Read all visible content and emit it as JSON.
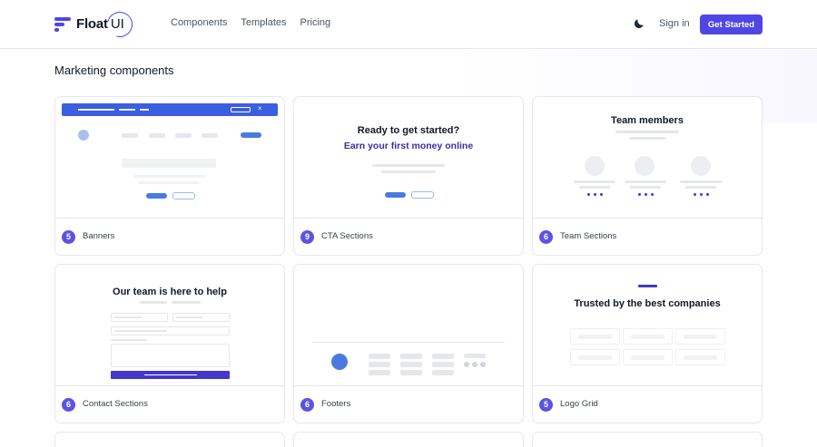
{
  "brand": {
    "name": "Float",
    "suffix": "UI"
  },
  "nav": [
    "Components",
    "Templates",
    "Pricing"
  ],
  "header": {
    "signin": "Sign in",
    "cta": "Get Started"
  },
  "section_title": "Marketing components",
  "cards": [
    {
      "count": "5",
      "label": "Banners"
    },
    {
      "count": "9",
      "label": "CTA Sections",
      "heading": "Ready to get started?",
      "subheading": "Earn your first money online"
    },
    {
      "count": "6",
      "label": "Team Sections",
      "heading": "Team members"
    },
    {
      "count": "6",
      "label": "Contact Sections",
      "heading": "Our team is here to help"
    },
    {
      "count": "6",
      "label": "Footers"
    },
    {
      "count": "5",
      "label": "Logo Grid",
      "heading": "Trusted by the best companies"
    }
  ],
  "colors": {
    "accent": "#4f46e5",
    "preview_blue": "#4a7ae0",
    "border": "#e5e7eb"
  },
  "icons": {
    "theme_toggle": "moon-icon",
    "banner_close": "close-icon"
  }
}
